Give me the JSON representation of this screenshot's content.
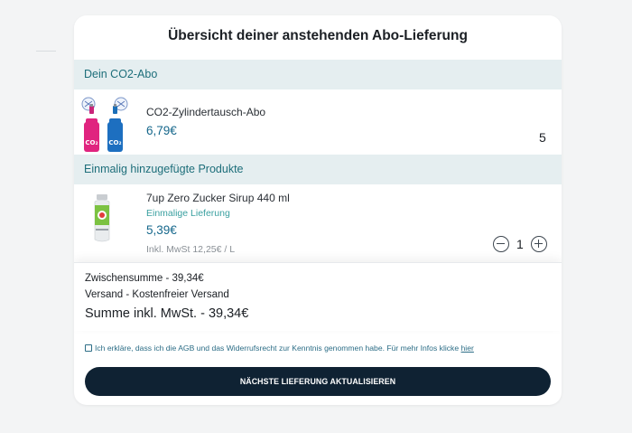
{
  "title": "Übersicht deiner anstehenden Abo-Lieferung",
  "subscription": {
    "section_label": "Dein CO2-Abo",
    "product_name": "CO2-Zylindertausch-Abo",
    "price": "6,79€",
    "quantity": "5",
    "image_labels": [
      "CO₂",
      "CO₂"
    ]
  },
  "one_time": {
    "section_label": "Einmalig hinzugefügte Produkte",
    "product_name": "7up Zero Zucker Sirup 440 ml",
    "note": "Einmalige Lieferung",
    "price": "5,39€",
    "unit_price": "Inkl. MwSt 12,25€ / L",
    "quantity": "1"
  },
  "summary": {
    "subtotal": "Zwischensumme - 39,34€",
    "shipping": "Versand - Kostenfreier Versand",
    "total": "Summe inkl. MwSt. - 39,34€"
  },
  "consent": {
    "text": "Ich erkläre, dass ich die AGB und das Widerrufsrecht zur Kenntnis genommen habe. Für mehr Infos klicke",
    "link": "hier",
    "checked": false
  },
  "cta_label": "NÄCHSTE LIEFERUNG AKTUALISIEREN",
  "colors": {
    "section_bg": "#e5eef0",
    "price": "#17688c",
    "button_bg": "#0f2233"
  }
}
